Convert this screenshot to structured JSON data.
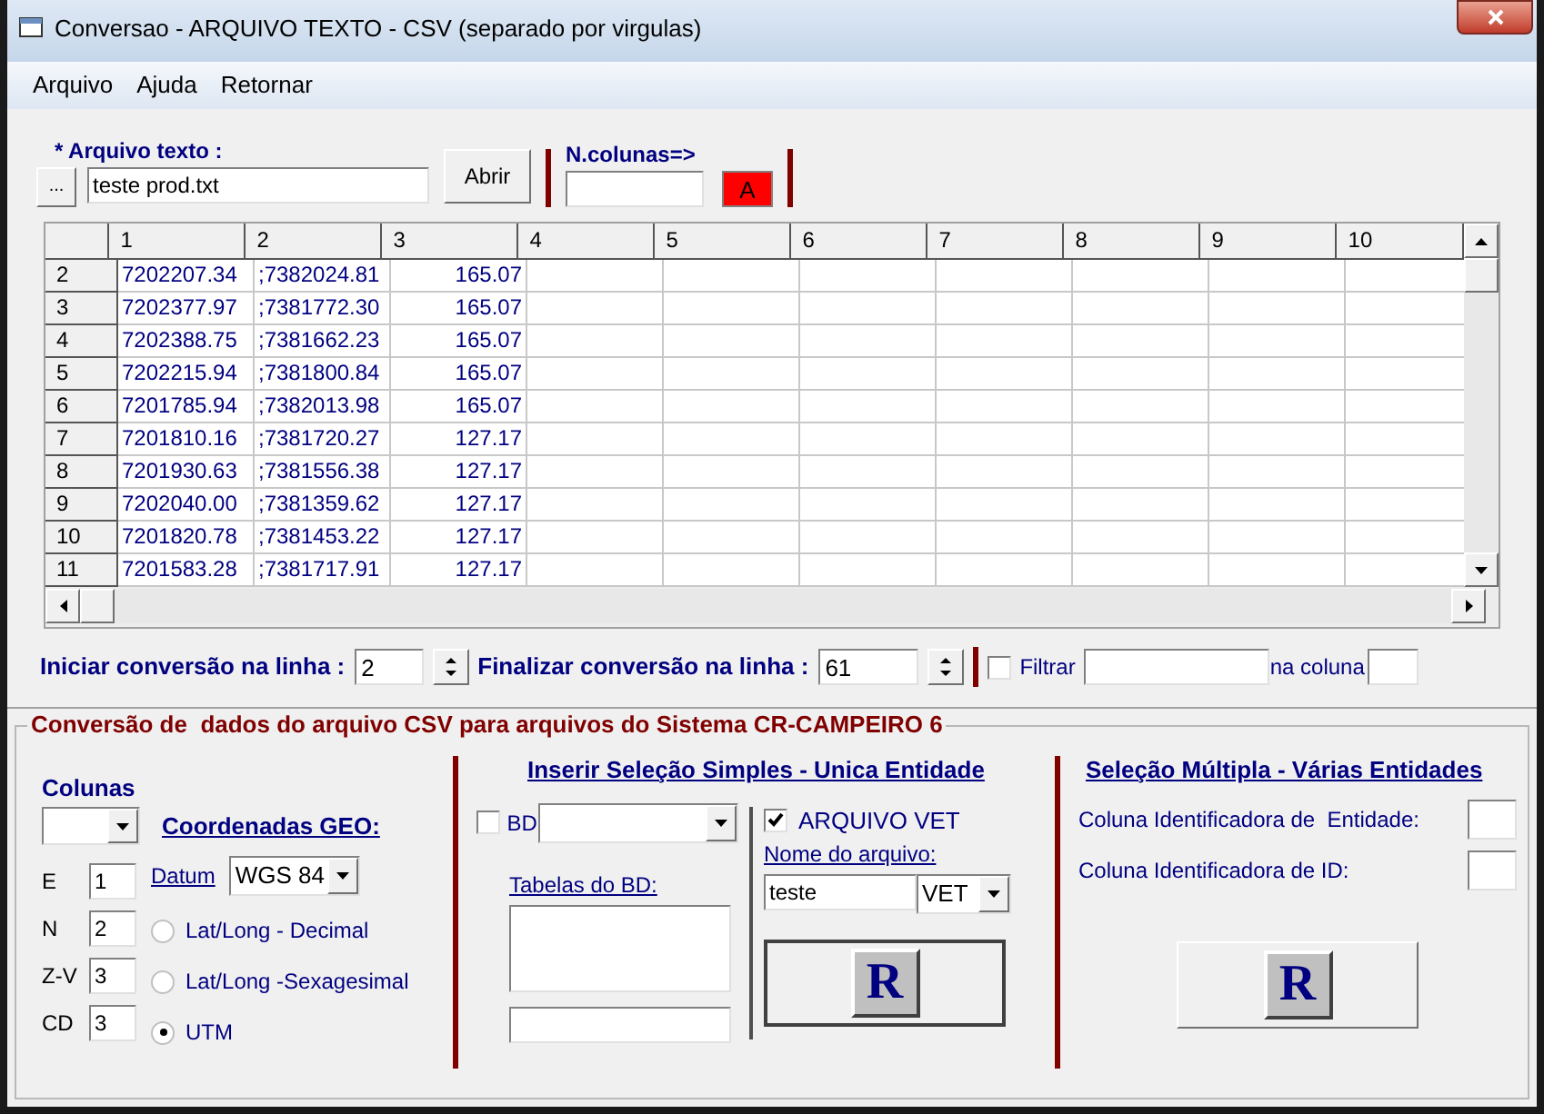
{
  "window": {
    "title": "Conversao - ARQUIVO TEXTO - CSV (separado por virgulas)"
  },
  "menu": [
    "Arquivo",
    "Ajuda",
    "Retornar"
  ],
  "file": {
    "label": "* Arquivo texto :",
    "browse_button": "...",
    "value": "teste prod.txt",
    "open_button": "Abrir"
  },
  "columns_count": {
    "label": "N.colunas=>",
    "button": "A"
  },
  "grid": {
    "columns": [
      "1",
      "2",
      "3",
      "4",
      "5",
      "6",
      "7",
      "8",
      "9",
      "10"
    ],
    "rows": [
      {
        "header": "2",
        "cells": [
          "7202207.34",
          ";7382024.81",
          "165.07"
        ]
      },
      {
        "header": "3",
        "cells": [
          "7202377.97",
          ";7381772.30",
          "165.07"
        ]
      },
      {
        "header": "4",
        "cells": [
          "7202388.75",
          ";7381662.23",
          "165.07"
        ]
      },
      {
        "header": "5",
        "cells": [
          "7202215.94",
          ";7381800.84",
          "165.07"
        ]
      },
      {
        "header": "6",
        "cells": [
          "7201785.94",
          ";7382013.98",
          "165.07"
        ]
      },
      {
        "header": "7",
        "cells": [
          "7201810.16",
          ";7381720.27",
          "127.17"
        ]
      },
      {
        "header": "8",
        "cells": [
          "7201930.63",
          ";7381556.38",
          "127.17"
        ]
      },
      {
        "header": "9",
        "cells": [
          "7202040.00",
          ";7381359.62",
          "127.17"
        ]
      },
      {
        "header": "10",
        "cells": [
          "7201820.78",
          ";7381453.22",
          "127.17"
        ]
      },
      {
        "header": "11",
        "cells": [
          "7201583.28",
          ";7381717.91",
          "127.17"
        ]
      }
    ]
  },
  "range": {
    "start_label": "Iniciar conversão na linha :",
    "start_value": "2",
    "end_label": "Finalizar conversão na linha :",
    "end_value": "61"
  },
  "filter": {
    "checked": false,
    "label": "Filtrar",
    "column_label": "na coluna"
  },
  "conversion": {
    "title": "Conversão de  dados do arquivo CSV para arquivos do Sistema CR-CAMPEIRO 6",
    "columns_label": "Colunas",
    "fields": [
      {
        "label": "E",
        "value": "1"
      },
      {
        "label": "N",
        "value": "2"
      },
      {
        "label": "Z-V",
        "value": "3"
      },
      {
        "label": "CD",
        "value": "3"
      }
    ],
    "geo_label": "Coordenadas GEO:",
    "datum_label": "Datum",
    "datum_value": "WGS 84",
    "options": [
      {
        "label": "Lat/Long - Decimal",
        "selected": false
      },
      {
        "label": "Lat/Long -Sexagesimal",
        "selected": false
      },
      {
        "label": "UTM",
        "selected": true
      }
    ],
    "simple": {
      "title": "Inserir Seleção Simples - Unica Entidade",
      "bd": {
        "label": "BD",
        "checked": false
      },
      "tables_label": "Tabelas do BD:",
      "vet": {
        "label": "ARQUIVO VET",
        "checked": true
      },
      "name_label": "Nome do arquivo:",
      "name_value": "teste",
      "ext_value": "VET",
      "run_button": "R"
    },
    "multiple": {
      "title": "Seleção Múltipla - Várias Entidades",
      "fields": [
        "Coluna Identificadora de  Entidade:",
        "Coluna Identificadora de ID:"
      ],
      "run_button": "R"
    }
  }
}
